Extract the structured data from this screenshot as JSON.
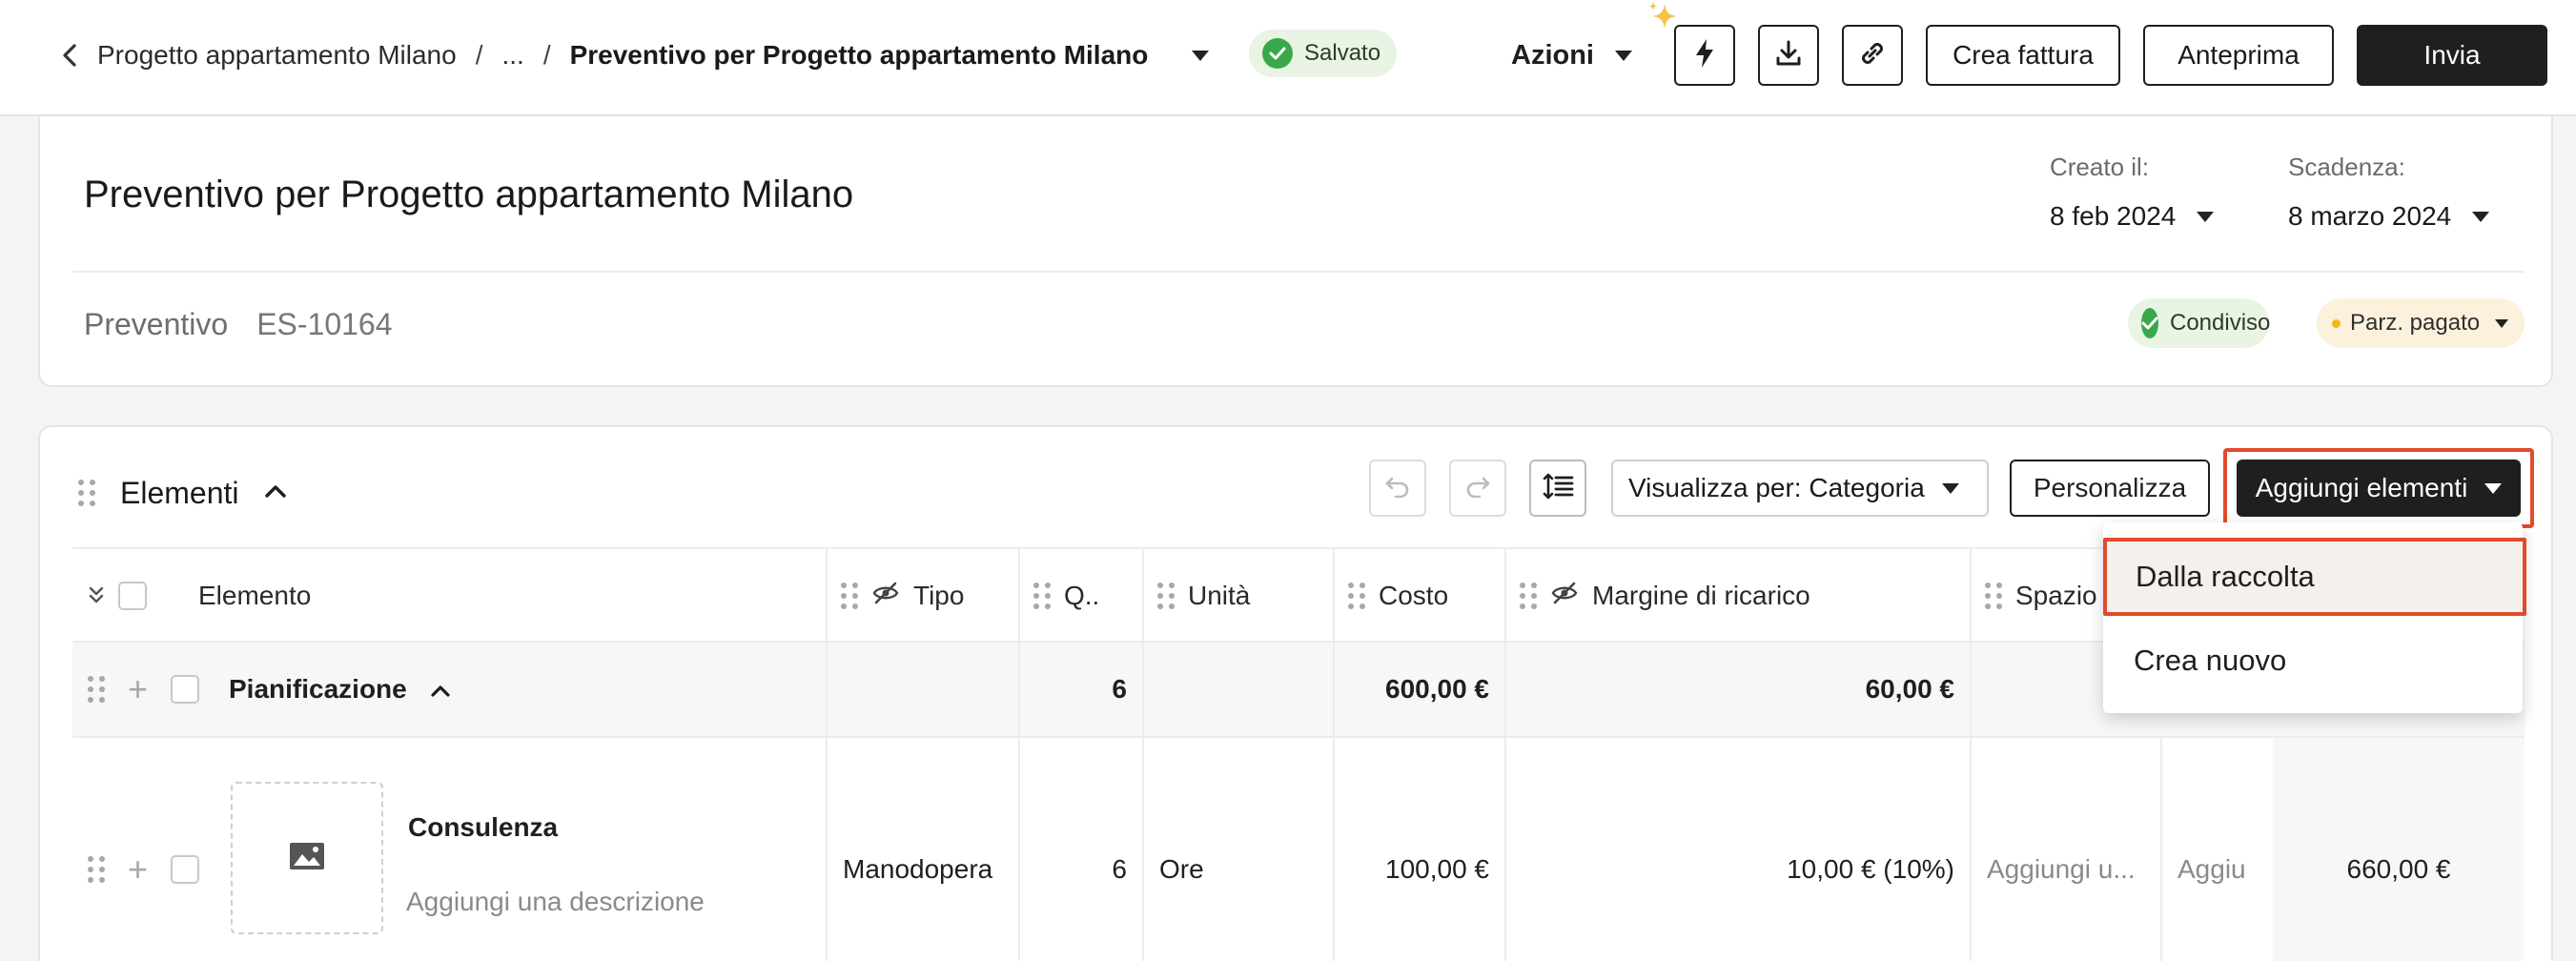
{
  "breadcrumb": {
    "parent": "Progetto appartamento Milano",
    "ellipsis": "...",
    "separator": "/",
    "current": "Preventivo per Progetto appartamento Milano"
  },
  "status": {
    "saved_label": "Salvato"
  },
  "toolbar": {
    "actions_label": "Azioni",
    "create_invoice_label": "Crea fattura",
    "preview_label": "Anteprima",
    "send_label": "Invia"
  },
  "header": {
    "title": "Preventivo per Progetto appartamento Milano",
    "created_label": "Creato il:",
    "created_value": "8 feb 2024",
    "due_label": "Scadenza:",
    "due_value": "8 marzo 2024",
    "doc_type": "Preventivo",
    "doc_number": "ES-10164",
    "shared_label": "Condiviso",
    "payment_status": "Parz. pagato"
  },
  "elements": {
    "title": "Elementi",
    "view_by_label": "Visualizza per: Categoria",
    "customize_label": "Personalizza",
    "add_items_label": "Aggiungi elementi",
    "columns": {
      "item": "Elemento",
      "type": "Tipo",
      "qty": "Q..",
      "unit": "Unità",
      "cost": "Costo",
      "markup": "Margine di ricarico",
      "space": "Spazio"
    },
    "group": {
      "name": "Pianificazione",
      "qty": "6",
      "cost": "600,00 €",
      "markup": "60,00 €"
    },
    "item": {
      "name": "Consulenza",
      "description_placeholder": "Aggiungi una descrizione",
      "type": "Manodopera",
      "qty": "6",
      "unit": "Ore",
      "cost": "100,00 €",
      "markup": "10,00 € (10%)",
      "space_placeholder": "Aggiungi u...",
      "extra_placeholder": "Aggiu",
      "total": "660,00 €"
    }
  },
  "dropdown": {
    "items": [
      {
        "label": "Dalla raccolta"
      },
      {
        "label": "Crea nuovo"
      }
    ]
  },
  "colors": {
    "accent_dark": "#1f1f1f",
    "success": "#3aa84a",
    "highlight_outline": "#e24a2c",
    "warning_dot": "#f2b818"
  },
  "icons": {
    "back": "chevron-left-icon",
    "bolt": "lightning-icon",
    "download": "download-icon",
    "link": "link-icon",
    "sparkle": "sparkle-icon",
    "undo": "undo-icon",
    "redo": "redo-icon",
    "line_height": "line-spacing-icon",
    "hidden": "eye-off-icon",
    "image": "image-icon"
  }
}
